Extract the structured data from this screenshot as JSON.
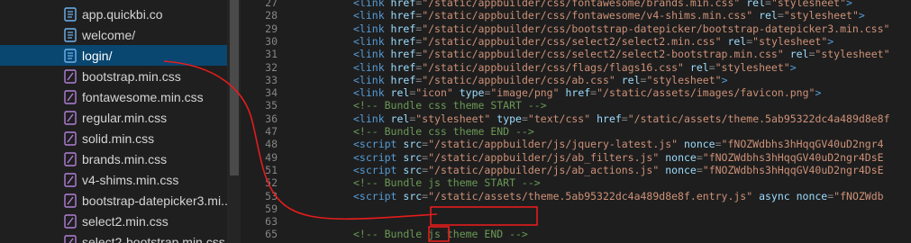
{
  "explorer": {
    "files": [
      {
        "name": "app.quickbi.co",
        "icon": "file-text-icon"
      },
      {
        "name": "welcome/",
        "icon": "file-text-icon"
      },
      {
        "name": "login/",
        "icon": "file-text-icon",
        "selected": true
      },
      {
        "name": "bootstrap.min.css",
        "icon": "css-file-icon"
      },
      {
        "name": "fontawesome.min.css",
        "icon": "css-file-icon"
      },
      {
        "name": "regular.min.css",
        "icon": "css-file-icon"
      },
      {
        "name": "solid.min.css",
        "icon": "css-file-icon"
      },
      {
        "name": "brands.min.css",
        "icon": "css-file-icon"
      },
      {
        "name": "v4-shims.min.css",
        "icon": "css-file-icon"
      },
      {
        "name": "bootstrap-datepicker3.mi...",
        "icon": "css-file-icon"
      },
      {
        "name": "select2.min.css",
        "icon": "css-file-icon"
      },
      {
        "name": "select2-bootstrap.min.css",
        "icon": "css-file-icon"
      }
    ]
  },
  "editor": {
    "line_numbers": [
      "27",
      "28",
      "29",
      "30",
      "31",
      "32",
      "33",
      "34",
      "35",
      "36",
      "47",
      "48",
      "49",
      "51",
      "52",
      "53",
      "59",
      "63",
      "65"
    ],
    "lines": [
      [
        [
          "tag",
          "<link "
        ],
        [
          "attr",
          "href"
        ],
        [
          "pun",
          "="
        ],
        [
          "str",
          "\"/static/appbuilder/css/fontawesome/brands.min.css\""
        ],
        [
          "attr",
          " rel"
        ],
        [
          "pun",
          "="
        ],
        [
          "str",
          "\"stylesheet\""
        ],
        [
          "tag",
          ">"
        ]
      ],
      [
        [
          "tag",
          "<link "
        ],
        [
          "attr",
          "href"
        ],
        [
          "pun",
          "="
        ],
        [
          "str",
          "\"/static/appbuilder/css/fontawesome/v4-shims.min.css\""
        ],
        [
          "attr",
          " rel"
        ],
        [
          "pun",
          "="
        ],
        [
          "str",
          "\"stylesheet\""
        ],
        [
          "tag",
          ">"
        ]
      ],
      [
        [
          "tag",
          "<link "
        ],
        [
          "attr",
          "href"
        ],
        [
          "pun",
          "="
        ],
        [
          "str",
          "\"/static/appbuilder/css/bootstrap-datepicker/bootstrap-datepicker3.min.css\""
        ]
      ],
      [
        [
          "tag",
          "<link "
        ],
        [
          "attr",
          "href"
        ],
        [
          "pun",
          "="
        ],
        [
          "str",
          "\"/static/appbuilder/css/select2/select2.min.css\""
        ],
        [
          "attr",
          " rel"
        ],
        [
          "pun",
          "="
        ],
        [
          "str",
          "\"stylesheet\""
        ],
        [
          "tag",
          ">"
        ]
      ],
      [
        [
          "tag",
          "<link "
        ],
        [
          "attr",
          "href"
        ],
        [
          "pun",
          "="
        ],
        [
          "str",
          "\"/static/appbuilder/css/select2/select2-bootstrap.min.css\""
        ],
        [
          "attr",
          " rel"
        ],
        [
          "pun",
          "="
        ],
        [
          "str",
          "\"stylesheet\""
        ]
      ],
      [
        [
          "tag",
          "<link "
        ],
        [
          "attr",
          "href"
        ],
        [
          "pun",
          "="
        ],
        [
          "str",
          "\"/static/appbuilder/css/flags/flags16.css\""
        ],
        [
          "attr",
          " rel"
        ],
        [
          "pun",
          "="
        ],
        [
          "str",
          "\"stylesheet\""
        ],
        [
          "tag",
          ">"
        ]
      ],
      [
        [
          "tag",
          "<link "
        ],
        [
          "attr",
          "href"
        ],
        [
          "pun",
          "="
        ],
        [
          "str",
          "\"/static/appbuilder/css/ab.css\""
        ],
        [
          "attr",
          " rel"
        ],
        [
          "pun",
          "="
        ],
        [
          "str",
          "\"stylesheet\""
        ],
        [
          "tag",
          ">"
        ]
      ],
      [
        [
          "tag",
          "<link "
        ],
        [
          "attr",
          "rel"
        ],
        [
          "pun",
          "="
        ],
        [
          "str",
          "\"icon\""
        ],
        [
          "attr",
          " type"
        ],
        [
          "pun",
          "="
        ],
        [
          "str",
          "\"image/png\""
        ],
        [
          "attr",
          " href"
        ],
        [
          "pun",
          "="
        ],
        [
          "str",
          "\"/static/assets/images/favicon.png\""
        ],
        [
          "tag",
          ">"
        ]
      ],
      [
        [
          "com",
          "<!-- Bundle css theme START -->"
        ]
      ],
      [
        [
          "tag",
          "<link "
        ],
        [
          "attr",
          "rel"
        ],
        [
          "pun",
          "="
        ],
        [
          "str",
          "\"stylesheet\""
        ],
        [
          "attr",
          " type"
        ],
        [
          "pun",
          "="
        ],
        [
          "str",
          "\"text/css\""
        ],
        [
          "attr",
          " href"
        ],
        [
          "pun",
          "="
        ],
        [
          "str",
          "\"/static/assets/theme.5ab95322dc4a489d8e8f"
        ]
      ],
      [
        [
          "com",
          "<!-- Bundle css theme END -->"
        ]
      ],
      [
        [
          "tag",
          "<script "
        ],
        [
          "attr",
          "src"
        ],
        [
          "pun",
          "="
        ],
        [
          "str",
          "\"/static/appbuilder/js/jquery-latest.js\""
        ],
        [
          "attr",
          " nonce"
        ],
        [
          "pun",
          "="
        ],
        [
          "str",
          "\"fNOZWdbhs3hHqqGV40uD2ngr4"
        ]
      ],
      [
        [
          "tag",
          "<script "
        ],
        [
          "attr",
          "src"
        ],
        [
          "pun",
          "="
        ],
        [
          "str",
          "\"/static/appbuilder/js/ab_filters.js\""
        ],
        [
          "attr",
          " nonce"
        ],
        [
          "pun",
          "="
        ],
        [
          "str",
          "\"fNOZWdbhs3hHqqGV40uD2ngr4DsE"
        ]
      ],
      [
        [
          "tag",
          "<script "
        ],
        [
          "attr",
          "src"
        ],
        [
          "pun",
          "="
        ],
        [
          "str",
          "\"/static/appbuilder/js/ab_actions.js\""
        ],
        [
          "attr",
          " nonce"
        ],
        [
          "pun",
          "="
        ],
        [
          "str",
          "\"fNOZWdbhs3hHqqGV40uD2ngr4DsE"
        ]
      ],
      [
        [
          "com",
          "<!-- Bundle js theme START -->"
        ]
      ],
      [
        [
          "tag",
          "<script "
        ],
        [
          "attr",
          "src"
        ],
        [
          "pun",
          "="
        ],
        [
          "str",
          "\"/static/assets/theme.5ab95322dc4a489d8e8f.entry.js\""
        ],
        [
          "attr",
          " async"
        ],
        [
          "attr",
          " nonce"
        ],
        [
          "pun",
          "="
        ],
        [
          "str",
          "\"fNOZWdb"
        ]
      ],
      [
        [
          "com",
          "<!-- Bundle js theme END -->"
        ]
      ]
    ]
  },
  "colors": {
    "tag": "#569cd6",
    "attribute": "#9cdcfe",
    "string": "#ce9178",
    "comment": "#6a9955",
    "annotation": "#e51c1c",
    "selection": "#094771"
  }
}
